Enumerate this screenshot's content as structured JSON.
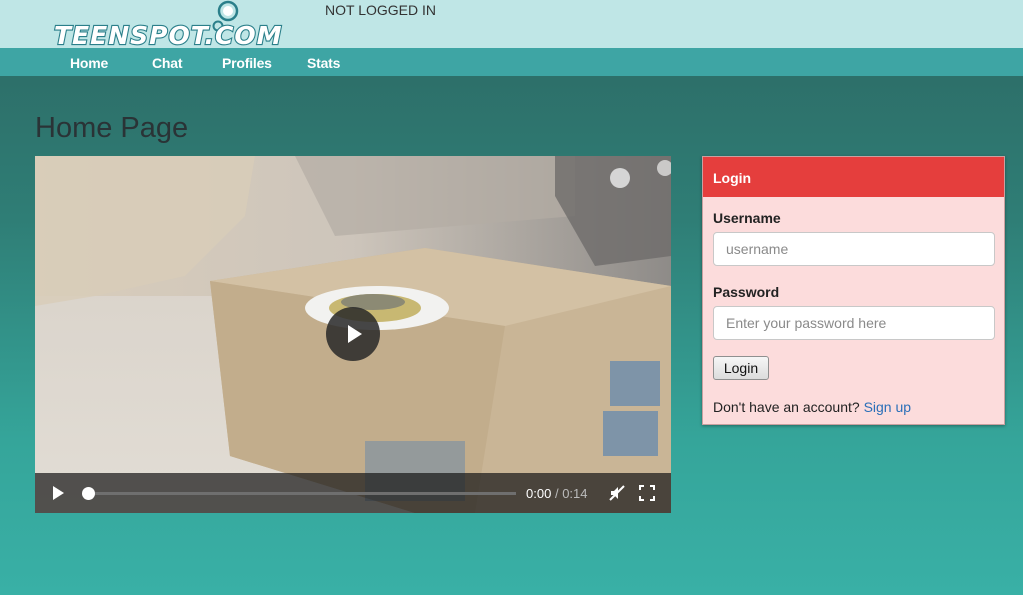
{
  "header": {
    "logo_text": "TEENSPOT.COM",
    "login_status": "NOT LOGGED IN"
  },
  "nav": {
    "items": [
      {
        "label": "Home"
      },
      {
        "label": "Chat"
      },
      {
        "label": "Profiles"
      },
      {
        "label": "Stats"
      }
    ]
  },
  "main": {
    "title": "Home Page"
  },
  "video": {
    "current_time": "0:00",
    "separator": "/",
    "duration": "0:14",
    "progress": 0,
    "icons": [
      "play-icon",
      "mute-icon",
      "fullscreen-icon"
    ]
  },
  "login": {
    "heading": "Login",
    "username_label": "Username",
    "username_placeholder": "username",
    "password_label": "Password",
    "password_placeholder": "Enter your password here",
    "button_label": "Login",
    "signup_prompt": "Don't have an account?",
    "signup_link": "Sign up"
  },
  "colors": {
    "topbar": "#bfe6e6",
    "navbar": "#3ea5a4",
    "login_header": "#e53e3d",
    "login_body": "#fcdcdc",
    "link": "#2a6fb8"
  }
}
